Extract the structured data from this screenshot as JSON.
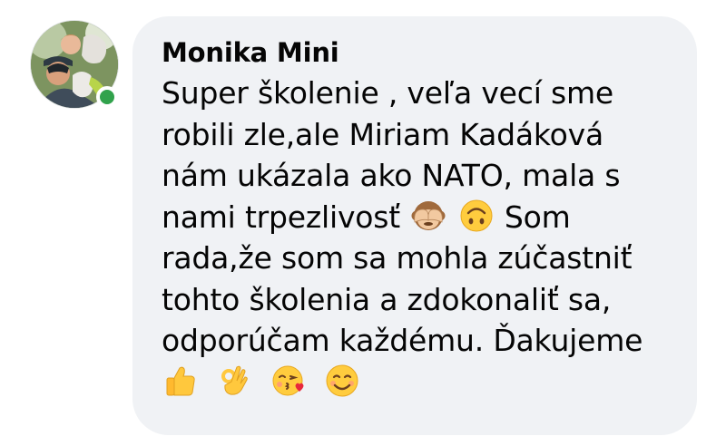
{
  "comment": {
    "author": "Monika Mini",
    "lines": [
      "Super školenie , veľa vecí sme",
      "robili zle,ale Miriam Kadáková",
      "nám ukázala ako NATO, mala s",
      "nami trpezlivosť",
      "Som",
      "rada,že som sa mohla zúčastniť",
      "tohto školenia a zdokonaliť sa,",
      "odporúčam každému. Ďakujeme"
    ],
    "inline_emojis": [
      "see-no-evil-monkey-emoji",
      "upside-down-face-emoji"
    ],
    "trailing_emojis": [
      "thumbs-up-emoji",
      "ok-hand-emoji",
      "face-blowing-kiss-emoji",
      "smiling-face-emoji"
    ]
  },
  "status": {
    "online": true,
    "online_color": "#31a24c"
  },
  "colors": {
    "bubble": "#f0f2f5",
    "text": "#050505"
  }
}
